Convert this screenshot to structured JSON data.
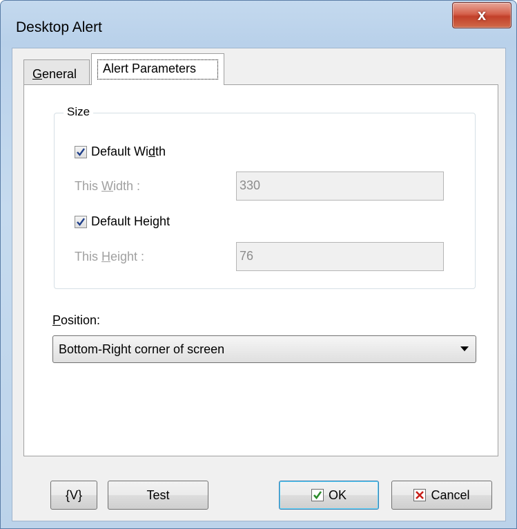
{
  "window": {
    "title": "Desktop Alert",
    "close_glyph": "x"
  },
  "tabs": [
    {
      "label_prefix": "",
      "mnemonic": "G",
      "label_suffix": "eneral",
      "selected": false
    },
    {
      "label": "Alert Parameters",
      "selected": true
    }
  ],
  "size_group": {
    "label": "Size",
    "default_width": {
      "prefix": "Default Wi",
      "mnemonic": "d",
      "suffix": "th",
      "checked": true
    },
    "this_width": {
      "prefix": "This ",
      "mnemonic": "W",
      "suffix": "idth :",
      "value": "330"
    },
    "default_height": {
      "label": "Default Height",
      "checked": true
    },
    "this_height": {
      "prefix": "This ",
      "mnemonic": "H",
      "suffix": "eight :",
      "value": "76"
    }
  },
  "position": {
    "mnemonic": "P",
    "label_suffix": "osition:",
    "selected": "Bottom-Right corner of screen"
  },
  "buttons": {
    "variables": "{V}",
    "test": "Test",
    "ok": "OK",
    "cancel": "Cancel"
  },
  "colors": {
    "accent_ok": "#2d8c2d",
    "cancel_x": "#c8201a",
    "check_mark": "#1f3f8a"
  }
}
